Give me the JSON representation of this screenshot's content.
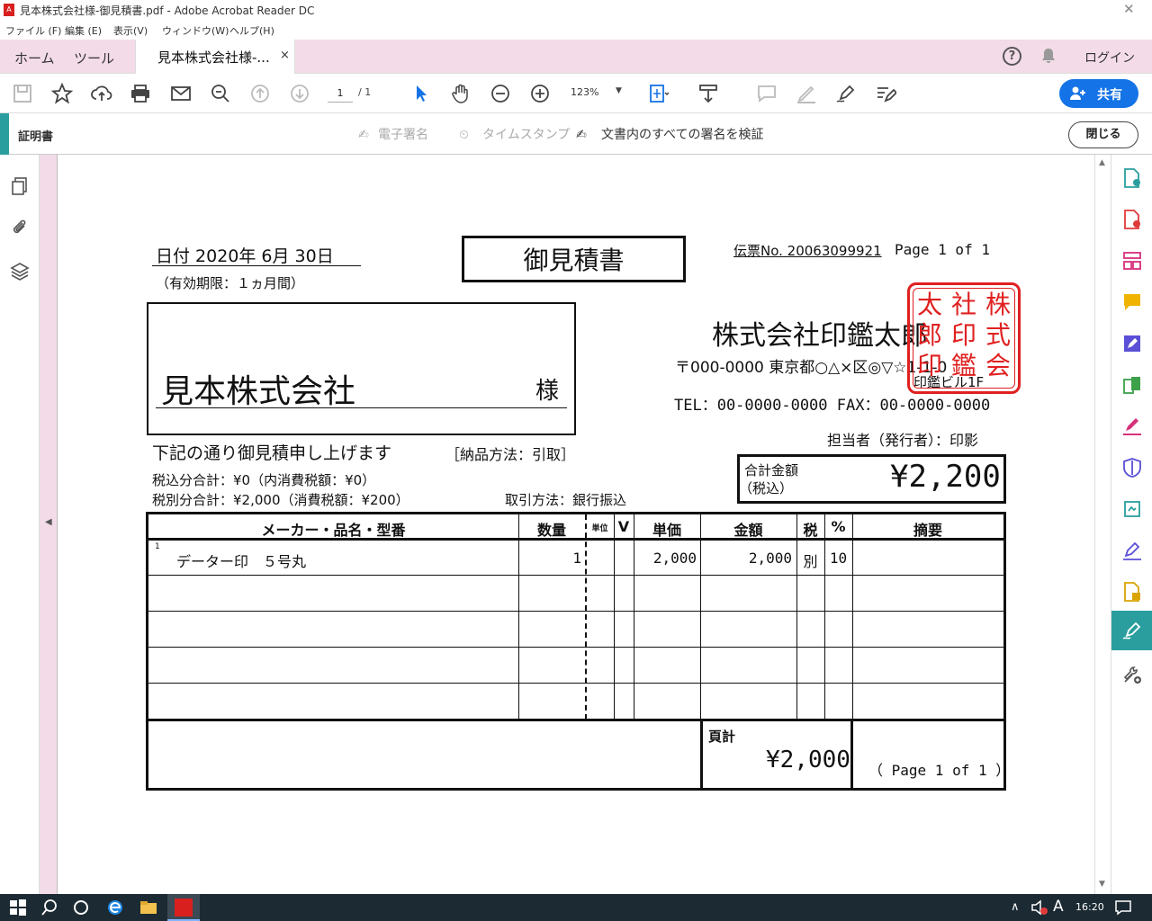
{
  "window": {
    "title": "見本株式会社様-御見積書.pdf - Adobe Acrobat Reader DC",
    "close": "✕"
  },
  "menu": [
    "ファイル (F)",
    "編集 (E)",
    "表示(V)",
    "ウィンドウ(W)",
    "ヘルプ(H)"
  ],
  "tabs": {
    "home": "ホーム",
    "tools": "ツール",
    "doc": "見本株式会社様-...",
    "doc_close": "×"
  },
  "header": {
    "help": "?",
    "login": "ログイン"
  },
  "toolbar": {
    "page_current": "1",
    "page_total": "/ 1",
    "zoom": "123%",
    "zoom_arrow": "▼",
    "share": "共有"
  },
  "certbar": {
    "title": "証明書",
    "digital_sign": "電子署名",
    "timestamp": "タイムスタンプ",
    "validate": "文書内のすべての署名を検証",
    "close": "閉じる"
  },
  "pane_arrow": "◀",
  "scroll": {
    "up": "▲",
    "down": "▼"
  },
  "taskbar": {
    "time": "16:20",
    "ime": "A",
    "chevron": "∧"
  },
  "document": {
    "date": "日付 2020年 6月 30日",
    "validity": "（有効期限：１ヵ月間）",
    "doc_title": "御見積書",
    "slip_no": "伝票No. 20063099921",
    "page_top": "Page 1 of 1",
    "customer": "見本株式会社",
    "honorific": "様",
    "company": "株式会社印鑑太郎",
    "address": "〒000-0000 東京都○△×区◎▽☆1-1-0",
    "building": "印鑑ビル1F",
    "tel_fax": "TEL：00-0000-0000 FAX：00-0000-0000",
    "contact": "担当者（発行者）：印影",
    "stamp_chars": [
      "株",
      "式",
      "会",
      "社",
      "印",
      "鑑",
      "太",
      "郎",
      "印"
    ],
    "intro": "下記の通り御見積申し上げます",
    "delivery": "［納品方法：引取］",
    "tax_incl": "税込分合計：¥0（内消費税額：¥0）",
    "tax_excl": "税別分合計：¥2,000（消費税額：¥200）",
    "payment": "取引方法：銀行振込",
    "total_label_1": "合計金額",
    "total_label_2": "（税込）",
    "total_amount": "¥2,200",
    "table": {
      "headers": [
        "メーカー・品名・型番",
        "数量",
        "単位",
        "V",
        "単価",
        "金額",
        "税",
        "%",
        "摘要"
      ],
      "rows": [
        {
          "no": "1",
          "item": "データー印　５号丸",
          "qty": "1",
          "unit": "",
          "v": "",
          "price": "2,000",
          "amount": "2,000",
          "tax": "別",
          "pct": "10",
          "note": ""
        },
        {
          "no": "",
          "item": "",
          "qty": "",
          "unit": "",
          "v": "",
          "price": "",
          "amount": "",
          "tax": "",
          "pct": "",
          "note": ""
        },
        {
          "no": "",
          "item": "",
          "qty": "",
          "unit": "",
          "v": "",
          "price": "",
          "amount": "",
          "tax": "",
          "pct": "",
          "note": ""
        },
        {
          "no": "",
          "item": "",
          "qty": "",
          "unit": "",
          "v": "",
          "price": "",
          "amount": "",
          "tax": "",
          "pct": "",
          "note": ""
        },
        {
          "no": "",
          "item": "",
          "qty": "",
          "unit": "",
          "v": "",
          "price": "",
          "amount": "",
          "tax": "",
          "pct": "",
          "note": ""
        }
      ]
    },
    "page_total_label": "頁計",
    "page_total_value": "¥2,000",
    "page_bottom": "（ Page 1 of 1 ）"
  },
  "colors": {
    "accent": "#2a9e9e",
    "tab_pink": "#f3dbe8",
    "share_blue": "#1473e6",
    "stamp_red": "#e02020",
    "taskbar": "#1c2a33"
  }
}
